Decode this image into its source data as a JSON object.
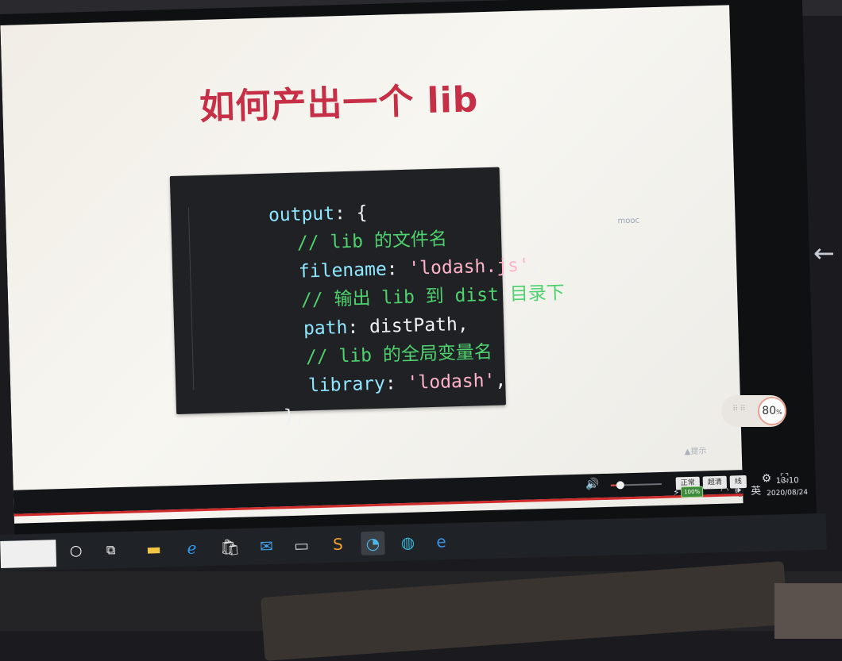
{
  "slide": {
    "title": "如何产出一个 lib",
    "watermark": "mooc"
  },
  "code": {
    "lines": [
      {
        "key": "output",
        "punc": ": {"
      },
      {
        "comment": "// lib 的文件名"
      },
      {
        "key": "filename",
        "punc": ": ",
        "str": "'lodash.js'",
        "tail": ","
      },
      {
        "comment": "// 输出 lib 到 dist 目录下"
      },
      {
        "key": "path",
        "punc": ": ",
        "id": "distPath",
        "tail": ","
      },
      {
        "comment": "// lib 的全局变量名"
      },
      {
        "key": "library",
        "punc": ": ",
        "str": "'lodash'",
        "tail": ","
      },
      {
        "punc": "},"
      }
    ]
  },
  "player": {
    "speed": "80",
    "speed_unit": "%",
    "volume": 0.18,
    "quality_buttons": [
      "正常",
      "超清",
      "线路"
    ],
    "hint_text": "▲提示"
  },
  "system_tray": {
    "battery": "100%",
    "ime": "英",
    "time": "13:10",
    "date": "2020/08/24"
  },
  "colors": {
    "title": "#c62f45",
    "code_bg": "#1f2125",
    "key": "#8fe7ff",
    "string": "#ffb3c8",
    "comment": "#4fd26e"
  }
}
